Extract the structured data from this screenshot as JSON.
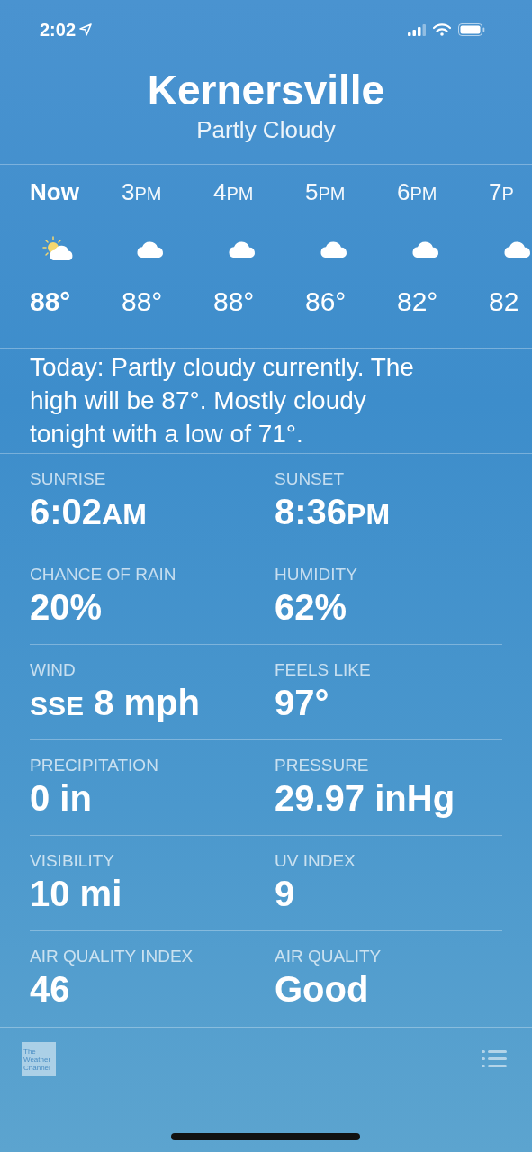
{
  "status_bar": {
    "time": "2:02"
  },
  "location": {
    "city": "Kernersville",
    "condition": "Partly Cloudy"
  },
  "hourly": [
    {
      "time": "Now",
      "current": true,
      "kind": "partly-sunny",
      "temp": "88°"
    },
    {
      "time": "3",
      "suffix": "PM",
      "current": false,
      "kind": "cloudy",
      "temp": "88°"
    },
    {
      "time": "4",
      "suffix": "PM",
      "current": false,
      "kind": "cloudy",
      "temp": "88°"
    },
    {
      "time": "5",
      "suffix": "PM",
      "current": false,
      "kind": "cloudy",
      "temp": "86°"
    },
    {
      "time": "6",
      "suffix": "PM",
      "current": false,
      "kind": "cloudy",
      "temp": "82°"
    },
    {
      "time": "7",
      "suffix": "P",
      "current": false,
      "kind": "cloudy",
      "temp": "82"
    }
  ],
  "summary": "Today: Partly cloudy currently. The high will be 87°. Mostly cloudy tonight with a low of 71°.",
  "details": [
    {
      "label": "SUNRISE",
      "value": "6:02",
      "suffix": "AM"
    },
    {
      "label": "SUNSET",
      "value": "8:36",
      "suffix": "PM"
    },
    {
      "label": "CHANCE OF RAIN",
      "value": "20%"
    },
    {
      "label": "HUMIDITY",
      "value": "62%"
    },
    {
      "label": "WIND",
      "prefix": "SSE",
      "value": "8 mph"
    },
    {
      "label": "FEELS LIKE",
      "value": "97°"
    },
    {
      "label": "PRECIPITATION",
      "value": "0 in"
    },
    {
      "label": "PRESSURE",
      "value": "29.97 inHg"
    },
    {
      "label": "VISIBILITY",
      "value": "10 mi"
    },
    {
      "label": "UV INDEX",
      "value": "9"
    },
    {
      "label": "AIR QUALITY INDEX",
      "value": "46"
    },
    {
      "label": "AIR QUALITY",
      "value": "Good"
    }
  ],
  "footer": {
    "logo": [
      "The",
      "Weather",
      "Channel"
    ]
  }
}
